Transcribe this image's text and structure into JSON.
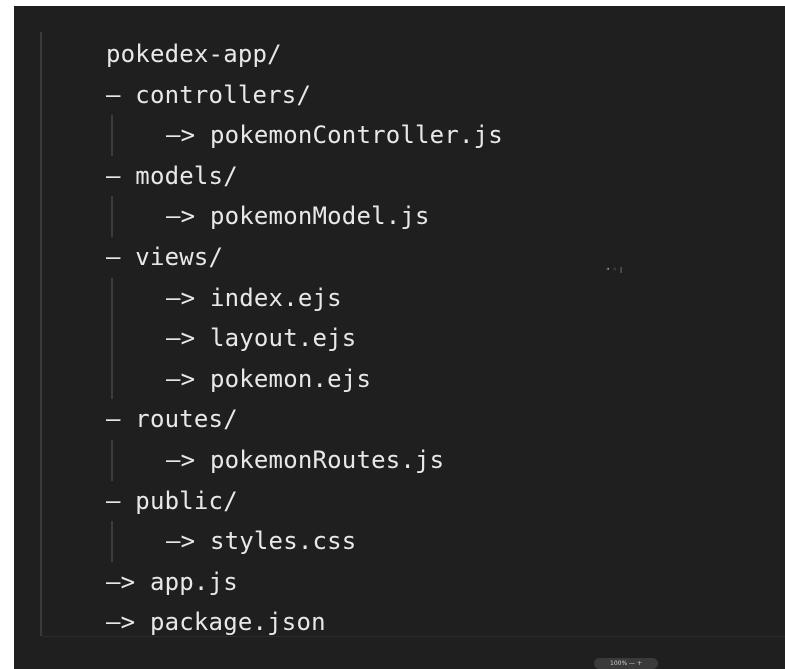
{
  "editor": {
    "lines": [
      {
        "text": "pokedex-app/",
        "indent": 0
      },
      {
        "text": "– controllers/",
        "indent": 0
      },
      {
        "text": "–> pokemonController.js",
        "indent": 1
      },
      {
        "text": "– models/",
        "indent": 0
      },
      {
        "text": "–> pokemonModel.js",
        "indent": 1
      },
      {
        "text": "– views/",
        "indent": 0
      },
      {
        "text": "–> index.ejs",
        "indent": 1
      },
      {
        "text": "–> layout.ejs",
        "indent": 1
      },
      {
        "text": "–> pokemon.ejs",
        "indent": 1
      },
      {
        "text": "– routes/",
        "indent": 0
      },
      {
        "text": "–> pokemonRoutes.js",
        "indent": 1
      },
      {
        "text": "– public/",
        "indent": 0
      },
      {
        "text": "–> styles.css",
        "indent": 1
      },
      {
        "text": "–> app.js",
        "indent": 0
      },
      {
        "text": "–> package.json",
        "indent": 0
      }
    ]
  },
  "overlay": {
    "stray_glyphs": "⁍ ◦ ׀",
    "zoom_label": "100%  —  +"
  },
  "colors": {
    "background": "#1f1f1f",
    "text": "#e8e8e8",
    "guide": "#3c3c3c"
  }
}
